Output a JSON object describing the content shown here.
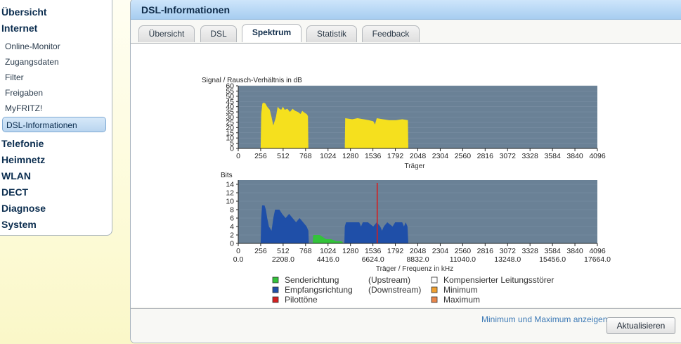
{
  "nav": {
    "main": [
      "Übersicht",
      "Internet"
    ],
    "sub": [
      "Online-Monitor",
      "Zugangsdaten",
      "Filter",
      "Freigaben",
      "MyFRITZ!",
      "DSL-Informationen"
    ],
    "main_after": [
      "Telefonie",
      "Heimnetz",
      "WLAN",
      "DECT",
      "Diagnose",
      "System"
    ]
  },
  "panel": {
    "title": "DSL-Informationen",
    "tabs": [
      "Übersicht",
      "DSL",
      "Spektrum",
      "Statistik",
      "Feedback"
    ],
    "active_tab": "Spektrum",
    "refresh_label": "Aktualisieren",
    "minmax_link": "Minimum und Maximum anzeigen"
  },
  "colors": {
    "plot_bg": "#6a8196",
    "snr": "#f5e01e",
    "upstream": "#33c33a",
    "downstream": "#1f4fa8",
    "pilot": "#d41f1f",
    "minimum": "#f0a030",
    "maximum": "#e8864a"
  },
  "legend": [
    {
      "label": "Senderichtung",
      "dir": "(Upstream)",
      "color": "#33c33a"
    },
    {
      "label": "Empfangsrichtung",
      "dir": "(Downstream)",
      "color": "#1f4fa8"
    },
    {
      "label": "Pilottöne",
      "dir": "",
      "color": "#d41f1f"
    },
    {
      "label": "Kompensierter Leitungsstörer",
      "dir": "",
      "color": "#ffffff"
    },
    {
      "label": "Minimum",
      "dir": "",
      "color": "#f0a030"
    },
    {
      "label": "Maximum",
      "dir": "",
      "color": "#e8864a"
    }
  ],
  "chart_data": [
    {
      "type": "area",
      "title": "Signal / Rausch-Verhältnis in dB",
      "xlabel": "Träger",
      "ylabel": "",
      "xlim": [
        0,
        4096
      ],
      "ylim": [
        0,
        60
      ],
      "x_ticks": [
        0,
        256,
        512,
        768,
        1024,
        1280,
        1536,
        1792,
        2048,
        2304,
        2560,
        2816,
        3072,
        3328,
        3584,
        3840,
        4096
      ],
      "y_ticks": [
        0,
        5,
        10,
        15,
        20,
        25,
        30,
        35,
        40,
        45,
        50,
        55,
        60
      ],
      "series": [
        {
          "color": "#f5e01e",
          "segments": [
            [
              [
                256,
                0
              ],
              [
                262,
                33
              ],
              [
                275,
                43
              ],
              [
                290,
                44
              ],
              [
                310,
                43
              ],
              [
                330,
                40
              ],
              [
                360,
                37
              ],
              [
                380,
                30
              ],
              [
                400,
                22
              ],
              [
                430,
                30
              ],
              [
                450,
                40
              ],
              [
                470,
                38
              ],
              [
                490,
                37
              ],
              [
                510,
                40
              ],
              [
                530,
                37
              ],
              [
                560,
                38
              ],
              [
                590,
                35
              ],
              [
                620,
                38
              ],
              [
                650,
                36
              ],
              [
                680,
                35
              ],
              [
                710,
                33
              ],
              [
                730,
                36
              ],
              [
                760,
                34
              ],
              [
                780,
                33
              ],
              [
                795,
                31
              ],
              [
                800,
                0
              ]
            ],
            [
              [
                1215,
                0
              ],
              [
                1220,
                29
              ],
              [
                1300,
                28
              ],
              [
                1360,
                29
              ],
              [
                1430,
                28
              ],
              [
                1490,
                27
              ],
              [
                1540,
                26
              ],
              [
                1560,
                23
              ],
              [
                1580,
                29
              ],
              [
                1650,
                28
              ],
              [
                1720,
                27
              ],
              [
                1800,
                27
              ],
              [
                1870,
                28
              ],
              [
                1935,
                27
              ],
              [
                1940,
                0
              ]
            ]
          ]
        }
      ]
    },
    {
      "type": "area",
      "title": "Bits",
      "xlabel": "Träger / Frequenz in kHz",
      "ylabel": "",
      "xlim": [
        0,
        4096
      ],
      "ylim": [
        0,
        15
      ],
      "x_ticks": [
        0,
        256,
        512,
        768,
        1024,
        1280,
        1536,
        1792,
        2048,
        2304,
        2560,
        2816,
        3072,
        3328,
        3584,
        3840,
        4096
      ],
      "x_freq_ticks": [
        "0.0",
        "2208.0",
        "4416.0",
        "6624.0",
        "8832.0",
        "11040.0",
        "13248.0",
        "15456.0",
        "17664.0"
      ],
      "y_ticks": [
        0,
        2,
        4,
        6,
        8,
        10,
        12,
        14
      ],
      "series": [
        {
          "name": "Empfangsrichtung",
          "color": "#1f4fa8",
          "segments": [
            [
              [
                256,
                0
              ],
              [
                262,
                6
              ],
              [
                272,
                9
              ],
              [
                300,
                9
              ],
              [
                315,
                8
              ],
              [
                330,
                6
              ],
              [
                350,
                4
              ],
              [
                380,
                3
              ],
              [
                400,
                6
              ],
              [
                420,
                8
              ],
              [
                470,
                8
              ],
              [
                500,
                7
              ],
              [
                540,
                6
              ],
              [
                580,
                7
              ],
              [
                620,
                6
              ],
              [
                660,
                5
              ],
              [
                700,
                6
              ],
              [
                740,
                5
              ],
              [
                780,
                4
              ],
              [
                800,
                3
              ],
              [
                805,
                0
              ]
            ],
            [
              [
                1210,
                0
              ],
              [
                1215,
                4
              ],
              [
                1230,
                5
              ],
              [
                1380,
                5
              ],
              [
                1400,
                4
              ],
              [
                1420,
                5
              ],
              [
                1480,
                5
              ],
              [
                1540,
                4
              ],
              [
                1580,
                5
              ],
              [
                1620,
                4
              ],
              [
                1640,
                3
              ],
              [
                1660,
                4
              ],
              [
                1700,
                5
              ],
              [
                1760,
                4
              ],
              [
                1790,
                5
              ],
              [
                1870,
                5
              ],
              [
                1890,
                4
              ],
              [
                1910,
                5
              ],
              [
                1930,
                4
              ],
              [
                1940,
                0
              ]
            ]
          ]
        },
        {
          "name": "Senderichtung",
          "color": "#33c33a",
          "segments": [
            [
              [
                850,
                0
              ],
              [
                855,
                2
              ],
              [
                930,
                2
              ],
              [
                1000,
                1
              ],
              [
                1060,
                1
              ],
              [
                1120,
                0.5
              ],
              [
                1180,
                0.5
              ],
              [
                1200,
                0
              ]
            ]
          ]
        },
        {
          "name": "Pilottöne",
          "color": "#d41f1f",
          "type": "pilot",
          "x": [
            1585
          ]
        }
      ]
    }
  ]
}
